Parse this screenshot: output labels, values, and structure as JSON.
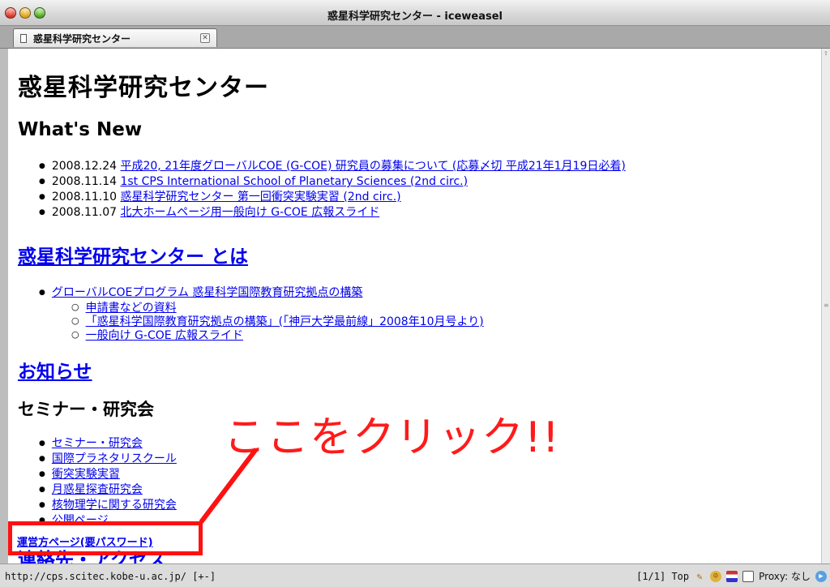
{
  "window": {
    "title": "惑星科学研究センター - iceweasel"
  },
  "tab": {
    "label": "惑星科学研究センター",
    "close": "✕"
  },
  "page": {
    "title": "惑星科学研究センター",
    "whats_new": {
      "heading": "What's New",
      "items": [
        {
          "date": "2008.12.24",
          "link": "平成20, 21年度グローバルCOE (G-COE) 研究員の募集について (応募〆切 平成21年1月19日必着)"
        },
        {
          "date": "2008.11.14",
          "link": "1st CPS International School of Planetary Sciences (2nd circ.)"
        },
        {
          "date": "2008.11.10",
          "link": "惑星科学研究センター 第一回衝突実験実習 (2nd circ.)"
        },
        {
          "date": "2008.11.07",
          "link": "北大ホームページ用一般向け G-COE 広報スライド"
        }
      ]
    },
    "about": {
      "heading": "惑星科学研究センター とは",
      "item": "グローバルCOEプログラム 惑星科学国際教育研究拠点の構築",
      "subitems": [
        "申請書などの資料",
        "「惑星科学国際教育研究拠点の構築」(「神戸大学最前線」2008年10月号より)",
        "一般向け G-COE 広報スライド"
      ]
    },
    "news_heading": "お知らせ",
    "seminar": {
      "heading": "セミナー・研究会",
      "items": [
        "セミナー・研究会",
        "国際プラネタリスクール",
        "衝突実験実習",
        "月惑星探査研究会",
        "核物理学に関する研究会",
        "公開ページ"
      ]
    },
    "contact_heading": "連絡先・アクセス",
    "admin_link": "運営方ページ(要パスワード)",
    "callout": "ここをクリック!!"
  },
  "statusbar": {
    "url": "http://cps.scitec.kobe-u.ac.jp/ [+-]",
    "position": "[1/1] Top",
    "proxy": "Proxy: なし"
  },
  "colors": {
    "link": "#0000ee",
    "callout": "#ff1a1a"
  },
  "icons": [
    "wrench-icon",
    "greasemonkey-icon",
    "flag-icon",
    "window-icon",
    "bird-icon"
  ]
}
